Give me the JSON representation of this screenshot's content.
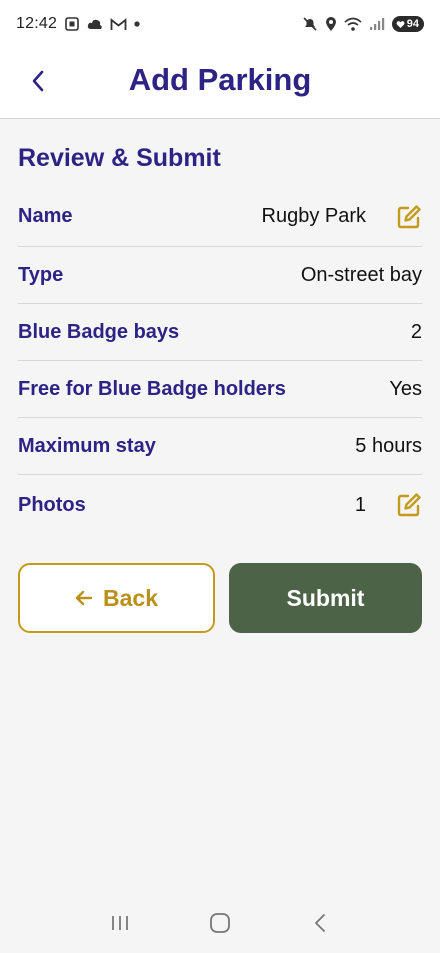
{
  "status_bar": {
    "time": "12:42",
    "battery": "94"
  },
  "header": {
    "title": "Add Parking"
  },
  "section": {
    "title": "Review & Submit"
  },
  "review": {
    "rows": [
      {
        "label": "Name",
        "value": "Rugby Park",
        "editable": true
      },
      {
        "label": "Type",
        "value": "On-street bay",
        "editable": false
      },
      {
        "label": "Blue Badge bays",
        "value": "2",
        "editable": false
      },
      {
        "label": "Free for Blue Badge holders",
        "value": "Yes",
        "editable": false
      },
      {
        "label": "Maximum stay",
        "value": "5 hours",
        "editable": false
      },
      {
        "label": "Photos",
        "value": "1",
        "editable": true
      }
    ]
  },
  "actions": {
    "back_label": "Back",
    "submit_label": "Submit"
  },
  "colors": {
    "primary": "#2c2385",
    "accent": "#c49a1c",
    "submit": "#4d6347"
  }
}
